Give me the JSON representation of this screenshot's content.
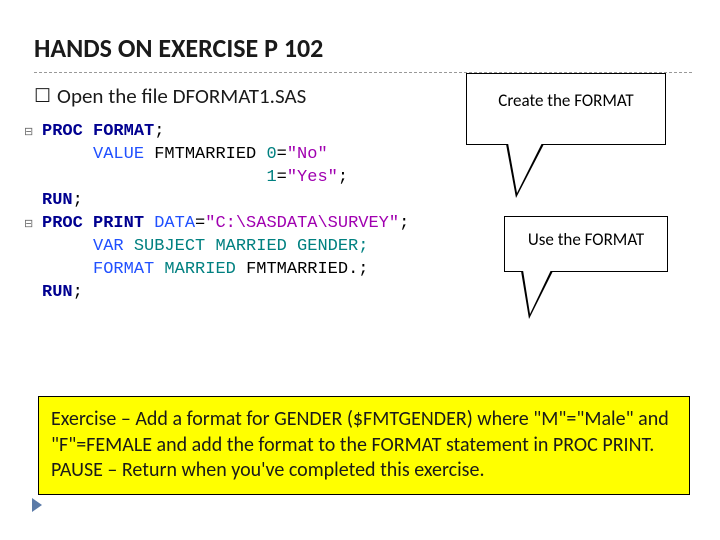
{
  "title": "HANDS ON EXERCISE P 102",
  "bullet": {
    "checkbox": "☐",
    "prefix": "Open ",
    "rest": "the file DFORMAT1.SAS"
  },
  "callout1": "Create the FORMAT",
  "callout2": "Use the FORMAT",
  "code": {
    "l1": {
      "a": "PROC",
      "b": " FORMAT",
      "c": ";"
    },
    "l2": {
      "a": "VALUE",
      "b": " FMTMARRIED ",
      "c": "0",
      "d": "=",
      "e": "\"No\""
    },
    "l3": {
      "a": "1",
      "b": "=",
      "c": "\"Yes\"",
      "d": ";"
    },
    "l4": {
      "a": "RUN",
      "b": ";"
    },
    "l5": {
      "a": "PROC",
      "b": " PRINT",
      "c": " DATA",
      "d": "=",
      "e": "\"C:\\SASDATA\\SURVEY\"",
      "f": ";"
    },
    "l6": {
      "a": "VAR",
      "b": " SUBJECT MARRIED GENDER;"
    },
    "l7": {
      "a": "FORMAT",
      "b": " MARRIED ",
      "c": "FMTMARRIED.",
      "d": ";"
    },
    "l8": {
      "a": "RUN",
      "b": ";"
    }
  },
  "exercise": "Exercise – Add a format for GENDER ($FMTGENDER) where \"M\"=\"Male\" and \"F\"=FEMALE and add the format to the FORMAT statement in PROC PRINT.\nPAUSE – Return when you've completed this exercise."
}
